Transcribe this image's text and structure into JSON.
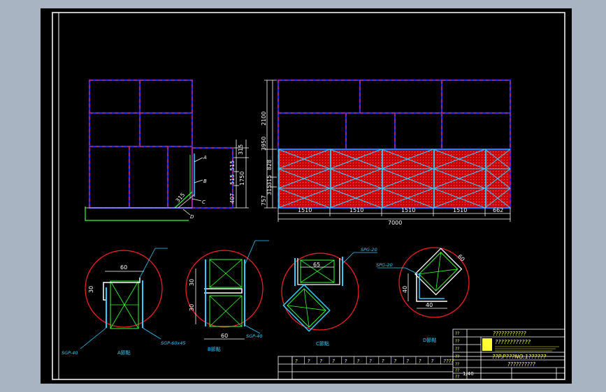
{
  "colors": {
    "background": "#000000",
    "border": "#ffffff",
    "frame_blue": "#1a2bff",
    "dash_red": "#ff2020",
    "cyan": "#33ccff",
    "green": "#33ff33",
    "yellow": "#ffff33",
    "circle_red": "#ff2020",
    "fill_red": "#cc0000"
  },
  "front_view": {
    "dims_vertical": [
      "2100",
      "3950",
      "828",
      "315",
      "315",
      "757"
    ],
    "dims_horizontal": [
      "1510",
      "1510",
      "1510",
      "1510",
      "662"
    ],
    "total_width": "7000"
  },
  "side_view": {
    "dims_vertical": [
      "315",
      "515",
      "515",
      "407",
      "1750"
    ],
    "angle_dim": "315",
    "markers": [
      "A",
      "B",
      "C",
      "D"
    ]
  },
  "details": [
    {
      "label": "A節點",
      "dims": [
        "60",
        "30"
      ],
      "tags": [
        "SGP-40",
        "SGP-60x45"
      ]
    },
    {
      "label": "B節點",
      "dims": [
        "30",
        "30",
        "60"
      ],
      "tags": [
        "SGP-40"
      ]
    },
    {
      "label": "C節點",
      "dims": [
        "65"
      ],
      "tags": [
        "SPG-20"
      ]
    },
    {
      "label": "D節點",
      "dims": [
        "60",
        "40",
        "40"
      ],
      "tags": [
        "SPG-20"
      ]
    }
  ],
  "title_block": {
    "company": "????????????",
    "project": "????????????",
    "drawing_no": "??P.P???NO.1??????",
    "drawing_name": "??????????",
    "scale": "1/40",
    "row_labels": [
      "??",
      "??",
      "??",
      "??",
      "??",
      "??",
      "??"
    ],
    "revision_cols": [
      "?",
      "?",
      "?",
      "?",
      "?",
      "?",
      "?",
      "?",
      "?",
      "?",
      "?",
      "?",
      "????"
    ]
  }
}
